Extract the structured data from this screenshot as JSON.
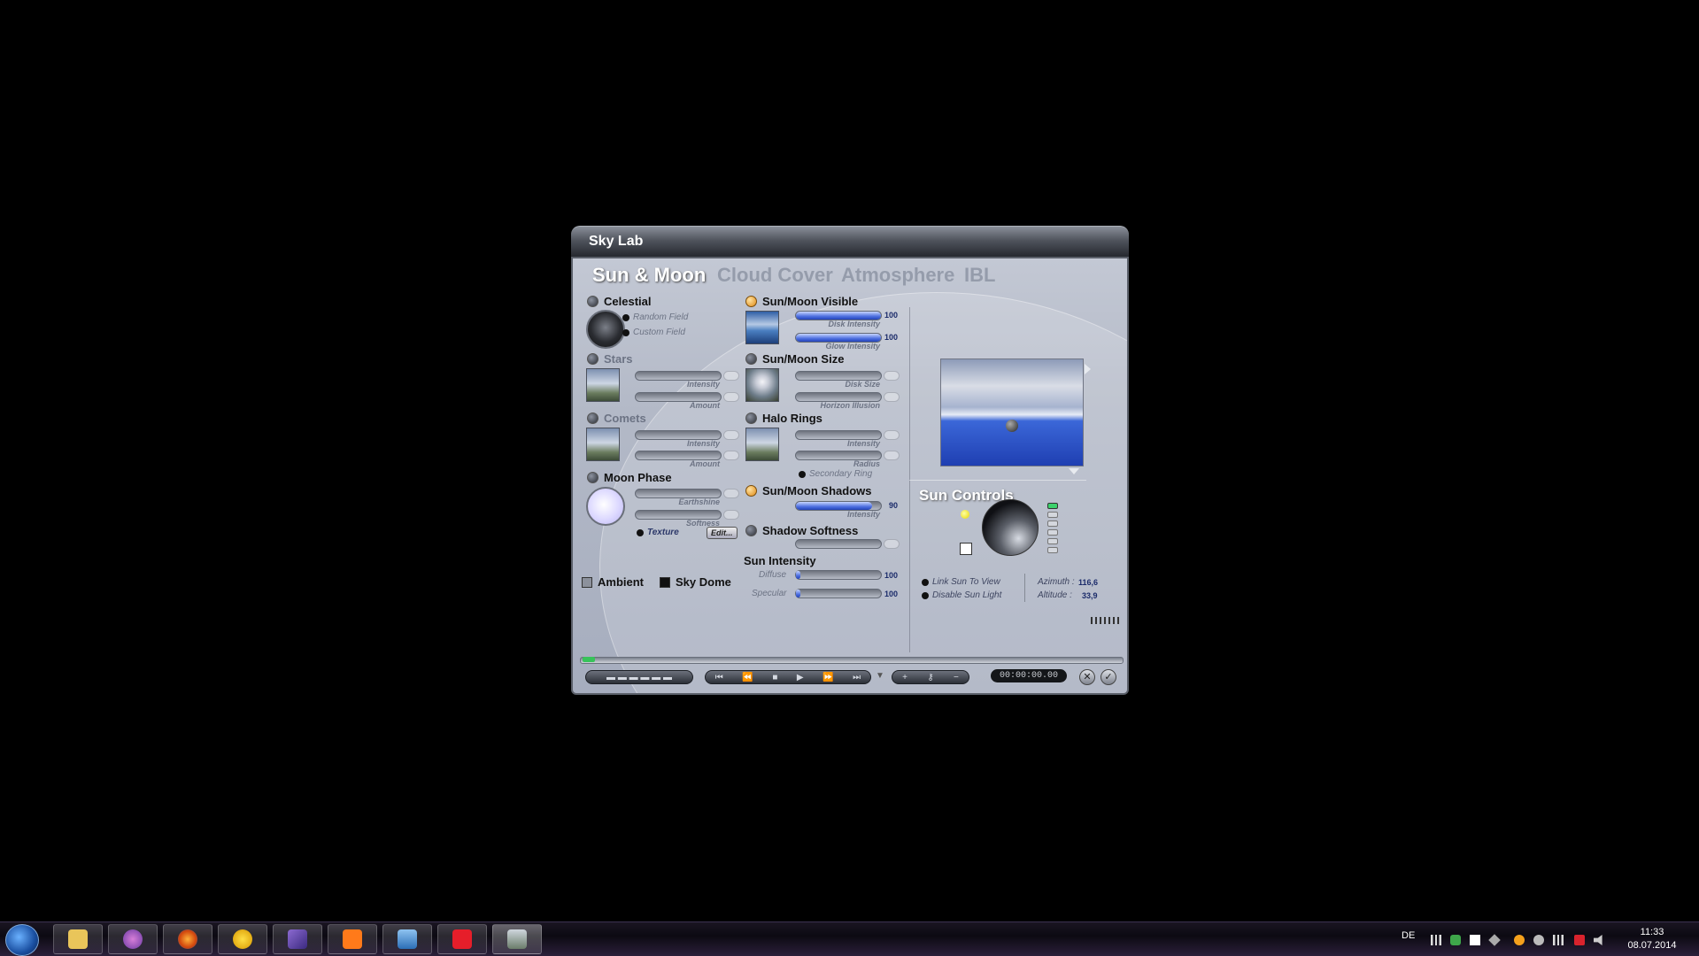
{
  "window": {
    "title": "Sky Lab"
  },
  "tabs": [
    "Sun & Moon",
    "Cloud Cover",
    "Atmosphere",
    "IBL"
  ],
  "celestial": {
    "label": "Celestial",
    "options": [
      "Random Field",
      "Custom Field"
    ]
  },
  "stars": {
    "label": "Stars",
    "sliders": [
      "Intensity",
      "Amount"
    ]
  },
  "comets": {
    "label": "Comets",
    "sliders": [
      "Intensity",
      "Amount"
    ]
  },
  "moon_phase": {
    "label": "Moon Phase",
    "sliders": [
      "Earthshine",
      "Softness"
    ],
    "texture_label": "Texture",
    "edit_label": "Edit..."
  },
  "sunmoon_visible": {
    "label": "Sun/Moon Visible",
    "disk_intensity": {
      "label": "Disk Intensity",
      "value": "100",
      "fraction": 1.0
    },
    "glow_intensity": {
      "label": "Glow Intensity",
      "value": "100",
      "fraction": 1.0
    }
  },
  "sunmoon_size": {
    "label": "Sun/Moon Size",
    "sliders": [
      "Disk Size",
      "Horizon Illusion"
    ]
  },
  "halo_rings": {
    "label": "Halo Rings",
    "sliders": [
      "Intensity",
      "Radius"
    ],
    "secondary": "Secondary Ring"
  },
  "sunmoon_shadows": {
    "label": "Sun/Moon Shadows",
    "intensity": {
      "label": "Intensity",
      "value": "90",
      "fraction": 0.9
    }
  },
  "shadow_softness": {
    "label": "Shadow Softness"
  },
  "sun_intensity": {
    "label": "Sun Intensity",
    "diffuse": {
      "label": "Diffuse",
      "value": "100",
      "fraction": 0.05
    },
    "specular": {
      "label": "Specular",
      "value": "100",
      "fraction": 0.05
    }
  },
  "ambient_label": "Ambient",
  "skydome_label": "Sky Dome",
  "sun_controls": {
    "title": "Sun Controls",
    "link_label": "Link Sun To View",
    "disable_label": "Disable Sun Light",
    "azimuth_label": "Azimuth :",
    "azimuth_value": "116,6",
    "altitude_label": "Altitude :",
    "altitude_value": "33,9"
  },
  "timecode": "00:00:00.00",
  "taskbar": {
    "language": "DE",
    "time": "11:33",
    "date": "08.07.2014",
    "apps": [
      "windows-explorer",
      "messenger",
      "firefox",
      "vlc-like",
      "visual-studio",
      "mail",
      "control-panel",
      "paint-app",
      "bryce"
    ]
  },
  "colors": {
    "accent": "#4d6fe0",
    "title_text": "#ffffff",
    "led_on": "#e08a16"
  }
}
